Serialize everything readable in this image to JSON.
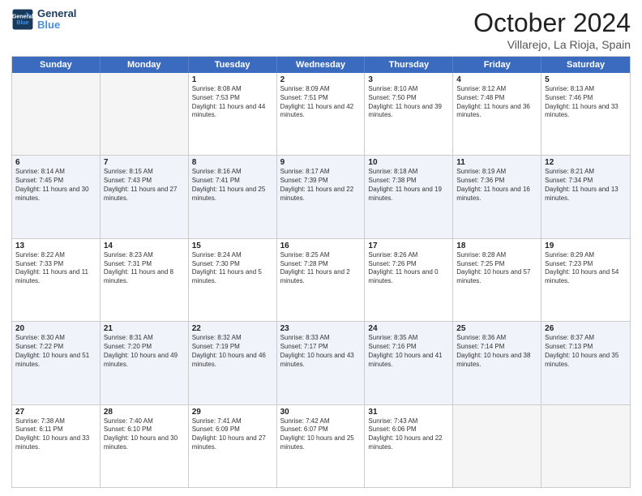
{
  "header": {
    "logo_line1": "General",
    "logo_line2": "Blue",
    "month": "October 2024",
    "location": "Villarejo, La Rioja, Spain"
  },
  "weekdays": [
    "Sunday",
    "Monday",
    "Tuesday",
    "Wednesday",
    "Thursday",
    "Friday",
    "Saturday"
  ],
  "rows": [
    [
      {
        "day": "",
        "text": "",
        "empty": true
      },
      {
        "day": "",
        "text": "",
        "empty": true
      },
      {
        "day": "1",
        "text": "Sunrise: 8:08 AM\nSunset: 7:53 PM\nDaylight: 11 hours and 44 minutes."
      },
      {
        "day": "2",
        "text": "Sunrise: 8:09 AM\nSunset: 7:51 PM\nDaylight: 11 hours and 42 minutes."
      },
      {
        "day": "3",
        "text": "Sunrise: 8:10 AM\nSunset: 7:50 PM\nDaylight: 11 hours and 39 minutes."
      },
      {
        "day": "4",
        "text": "Sunrise: 8:12 AM\nSunset: 7:48 PM\nDaylight: 11 hours and 36 minutes."
      },
      {
        "day": "5",
        "text": "Sunrise: 8:13 AM\nSunset: 7:46 PM\nDaylight: 11 hours and 33 minutes."
      }
    ],
    [
      {
        "day": "6",
        "text": "Sunrise: 8:14 AM\nSunset: 7:45 PM\nDaylight: 11 hours and 30 minutes."
      },
      {
        "day": "7",
        "text": "Sunrise: 8:15 AM\nSunset: 7:43 PM\nDaylight: 11 hours and 27 minutes."
      },
      {
        "day": "8",
        "text": "Sunrise: 8:16 AM\nSunset: 7:41 PM\nDaylight: 11 hours and 25 minutes."
      },
      {
        "day": "9",
        "text": "Sunrise: 8:17 AM\nSunset: 7:39 PM\nDaylight: 11 hours and 22 minutes."
      },
      {
        "day": "10",
        "text": "Sunrise: 8:18 AM\nSunset: 7:38 PM\nDaylight: 11 hours and 19 minutes."
      },
      {
        "day": "11",
        "text": "Sunrise: 8:19 AM\nSunset: 7:36 PM\nDaylight: 11 hours and 16 minutes."
      },
      {
        "day": "12",
        "text": "Sunrise: 8:21 AM\nSunset: 7:34 PM\nDaylight: 11 hours and 13 minutes."
      }
    ],
    [
      {
        "day": "13",
        "text": "Sunrise: 8:22 AM\nSunset: 7:33 PM\nDaylight: 11 hours and 11 minutes."
      },
      {
        "day": "14",
        "text": "Sunrise: 8:23 AM\nSunset: 7:31 PM\nDaylight: 11 hours and 8 minutes."
      },
      {
        "day": "15",
        "text": "Sunrise: 8:24 AM\nSunset: 7:30 PM\nDaylight: 11 hours and 5 minutes."
      },
      {
        "day": "16",
        "text": "Sunrise: 8:25 AM\nSunset: 7:28 PM\nDaylight: 11 hours and 2 minutes."
      },
      {
        "day": "17",
        "text": "Sunrise: 8:26 AM\nSunset: 7:26 PM\nDaylight: 11 hours and 0 minutes."
      },
      {
        "day": "18",
        "text": "Sunrise: 8:28 AM\nSunset: 7:25 PM\nDaylight: 10 hours and 57 minutes."
      },
      {
        "day": "19",
        "text": "Sunrise: 8:29 AM\nSunset: 7:23 PM\nDaylight: 10 hours and 54 minutes."
      }
    ],
    [
      {
        "day": "20",
        "text": "Sunrise: 8:30 AM\nSunset: 7:22 PM\nDaylight: 10 hours and 51 minutes."
      },
      {
        "day": "21",
        "text": "Sunrise: 8:31 AM\nSunset: 7:20 PM\nDaylight: 10 hours and 49 minutes."
      },
      {
        "day": "22",
        "text": "Sunrise: 8:32 AM\nSunset: 7:19 PM\nDaylight: 10 hours and 46 minutes."
      },
      {
        "day": "23",
        "text": "Sunrise: 8:33 AM\nSunset: 7:17 PM\nDaylight: 10 hours and 43 minutes."
      },
      {
        "day": "24",
        "text": "Sunrise: 8:35 AM\nSunset: 7:16 PM\nDaylight: 10 hours and 41 minutes."
      },
      {
        "day": "25",
        "text": "Sunrise: 8:36 AM\nSunset: 7:14 PM\nDaylight: 10 hours and 38 minutes."
      },
      {
        "day": "26",
        "text": "Sunrise: 8:37 AM\nSunset: 7:13 PM\nDaylight: 10 hours and 35 minutes."
      }
    ],
    [
      {
        "day": "27",
        "text": "Sunrise: 7:38 AM\nSunset: 6:11 PM\nDaylight: 10 hours and 33 minutes."
      },
      {
        "day": "28",
        "text": "Sunrise: 7:40 AM\nSunset: 6:10 PM\nDaylight: 10 hours and 30 minutes."
      },
      {
        "day": "29",
        "text": "Sunrise: 7:41 AM\nSunset: 6:09 PM\nDaylight: 10 hours and 27 minutes."
      },
      {
        "day": "30",
        "text": "Sunrise: 7:42 AM\nSunset: 6:07 PM\nDaylight: 10 hours and 25 minutes."
      },
      {
        "day": "31",
        "text": "Sunrise: 7:43 AM\nSunset: 6:06 PM\nDaylight: 10 hours and 22 minutes."
      },
      {
        "day": "",
        "text": "",
        "empty": true
      },
      {
        "day": "",
        "text": "",
        "empty": true
      }
    ]
  ]
}
